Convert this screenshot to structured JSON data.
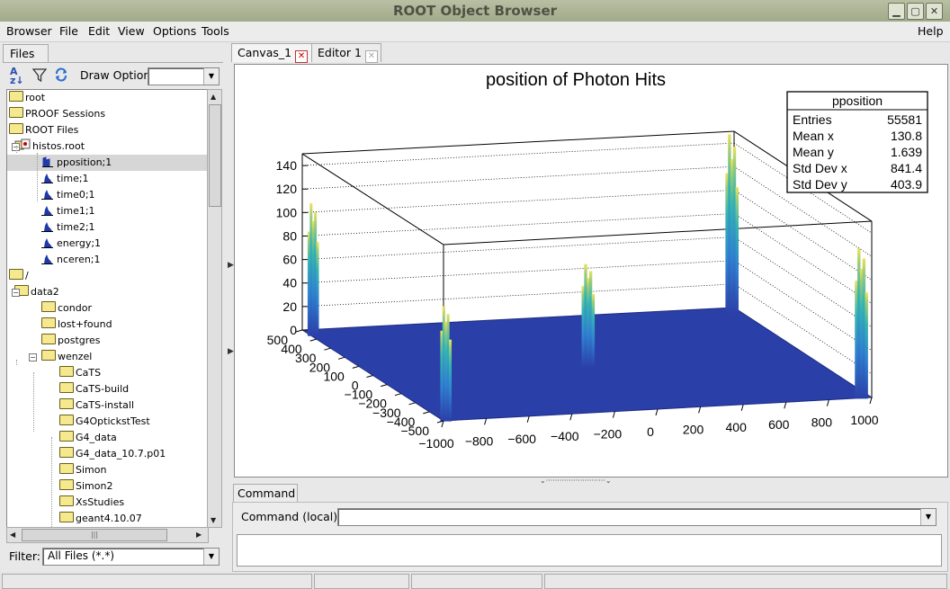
{
  "window": {
    "title": "ROOT Object Browser"
  },
  "menu": {
    "browser": "Browser",
    "file": "File",
    "edit": "Edit",
    "view": "View",
    "options": "Options",
    "tools": "Tools",
    "help": "Help"
  },
  "left": {
    "tab": "Files",
    "draw_option_label": "Draw Option:",
    "draw_option_value": "",
    "filter_label": "Filter:",
    "filter_value": "All Files (*.*)",
    "tree": [
      {
        "label": "root",
        "kind": "folder",
        "level": 0,
        "selected": false
      },
      {
        "label": "PROOF Sessions",
        "kind": "folder",
        "level": 0,
        "selected": false
      },
      {
        "label": "ROOT Files",
        "kind": "folder",
        "level": 0,
        "selected": false
      },
      {
        "label": "histos.root",
        "kind": "rootfile",
        "level": 1,
        "selected": false
      },
      {
        "label": "pposition;1",
        "kind": "th2",
        "level": 2,
        "selected": true
      },
      {
        "label": "time;1",
        "kind": "th1",
        "level": 2,
        "selected": false
      },
      {
        "label": "time0;1",
        "kind": "th1",
        "level": 2,
        "selected": false
      },
      {
        "label": "time1;1",
        "kind": "th1",
        "level": 2,
        "selected": false
      },
      {
        "label": "time2;1",
        "kind": "th1",
        "level": 2,
        "selected": false
      },
      {
        "label": "energy;1",
        "kind": "th1",
        "level": 2,
        "selected": false
      },
      {
        "label": "nceren;1",
        "kind": "th1",
        "level": 2,
        "selected": false
      },
      {
        "label": "/",
        "kind": "folder",
        "level": 0,
        "selected": false
      },
      {
        "label": "data2",
        "kind": "folder",
        "level": 1,
        "selected": false
      },
      {
        "label": "condor",
        "kind": "folder",
        "level": 2,
        "selected": false
      },
      {
        "label": "lost+found",
        "kind": "folder",
        "level": 2,
        "selected": false
      },
      {
        "label": "postgres",
        "kind": "folder",
        "level": 2,
        "selected": false
      },
      {
        "label": "wenzel",
        "kind": "folder",
        "level": 2,
        "selected": false
      },
      {
        "label": "CaTS",
        "kind": "folder",
        "level": 3,
        "selected": false
      },
      {
        "label": "CaTS-build",
        "kind": "folder",
        "level": 3,
        "selected": false
      },
      {
        "label": "CaTS-install",
        "kind": "folder",
        "level": 3,
        "selected": false
      },
      {
        "label": "G4OptickstTest",
        "kind": "folder",
        "level": 3,
        "selected": false
      },
      {
        "label": "G4_data",
        "kind": "folder",
        "level": 3,
        "selected": false
      },
      {
        "label": "G4_data_10.7.p01",
        "kind": "folder",
        "level": 3,
        "selected": false
      },
      {
        "label": "Simon",
        "kind": "folder",
        "level": 3,
        "selected": false
      },
      {
        "label": "Simon2",
        "kind": "folder",
        "level": 3,
        "selected": false
      },
      {
        "label": "XsStudies",
        "kind": "folder",
        "level": 3,
        "selected": false
      },
      {
        "label": "geant4.10.07",
        "kind": "folder",
        "level": 3,
        "selected": false
      }
    ]
  },
  "tabs": [
    {
      "label": "Canvas_1",
      "closable": true
    },
    {
      "label": "Editor 1",
      "closable": false
    }
  ],
  "plot": {
    "title": "position of Photon Hits",
    "stats": {
      "name": "pposition",
      "rows": [
        {
          "label": "Entries",
          "value": "55581"
        },
        {
          "label": "Mean x",
          "value": "130.8"
        },
        {
          "label": "Mean y",
          "value": "1.639"
        },
        {
          "label": "Std Dev x",
          "value": "841.4"
        },
        {
          "label": "Std Dev y",
          "value": "403.9"
        }
      ]
    },
    "z_ticks": [
      "0",
      "20",
      "40",
      "60",
      "80",
      "100",
      "120",
      "140"
    ],
    "x_ticks": [
      "−1000",
      "−800",
      "−600",
      "−400",
      "−200",
      "0",
      "200",
      "400",
      "600",
      "800",
      "1000"
    ],
    "y_ticks": [
      "500",
      "400",
      "300",
      "200",
      "100",
      "0",
      "−100",
      "−200",
      "−300",
      "−400",
      "−500"
    ],
    "colors": {
      "floor": "#2b3fa8",
      "peak_low": "#2f6fc9",
      "peak_mid": "#33b0b5",
      "peak_top": "#e8e05a"
    }
  },
  "chart_data": {
    "type": "lego",
    "title": "position of Photon Hits",
    "xlim": [
      -1000,
      1000
    ],
    "ylim": [
      -500,
      500
    ],
    "zlim": [
      0,
      150
    ],
    "peaks": [
      {
        "x": -1000,
        "y": 500,
        "z": 110
      },
      {
        "x": -1000,
        "y": -500,
        "z": 95
      },
      {
        "x": 0,
        "y": 0,
        "z": 85
      },
      {
        "x": 1000,
        "y": 500,
        "z": 150
      },
      {
        "x": 1000,
        "y": -500,
        "z": 125
      }
    ]
  },
  "command": {
    "tab": "Command",
    "label": "Command (local):",
    "value": ""
  }
}
